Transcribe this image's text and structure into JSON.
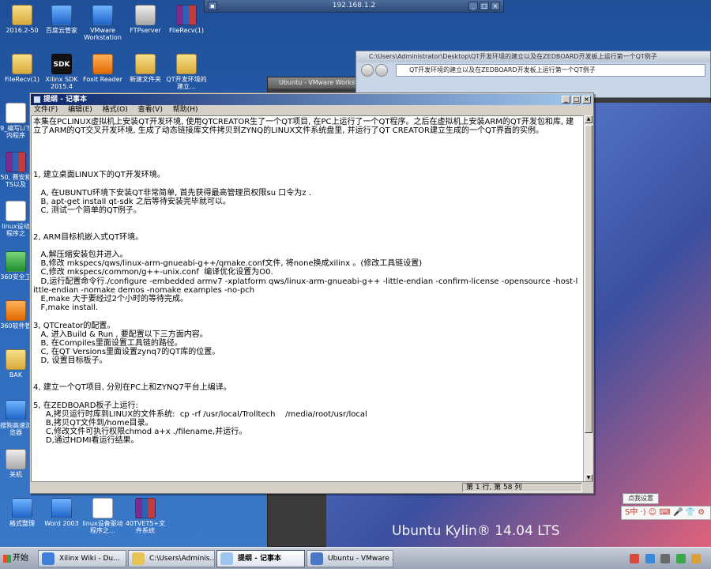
{
  "desktop": {
    "icons": [
      {
        "label": "2016.2-50",
        "icon": "folder-icon"
      },
      {
        "label": "百度云管家",
        "icon": "baidu-cloud-icon"
      },
      {
        "label": "VMware Workstation",
        "icon": "vmware-icon"
      },
      {
        "label": "FTPserver",
        "icon": "ftp-server-icon"
      },
      {
        "label": "FileRecv(1)",
        "icon": "winrar-archive-icon"
      },
      {
        "label": "FileRecv(1)",
        "icon": "folder-icon"
      },
      {
        "label": "Xilinx SDK 2015.4",
        "icon": "xilinx-sdk-icon"
      },
      {
        "label": "Foxit Reader",
        "icon": "foxit-reader-icon"
      },
      {
        "label": "新建文件夹",
        "icon": "folder-icon"
      },
      {
        "label": "QT开发环境的建立…",
        "icon": "folder-icon"
      },
      {
        "label": "9_编写Li下内程序",
        "icon": "document-icon"
      },
      {
        "label": "50, 赛安和TS以及",
        "icon": "winrar-archive-icon"
      },
      {
        "label": "linux设动程序之",
        "icon": "document-icon"
      },
      {
        "label": "360安全卫",
        "icon": "security-360-icon"
      },
      {
        "label": "360软件管",
        "icon": "software-360-icon"
      },
      {
        "label": "BAK",
        "icon": "folder-icon"
      },
      {
        "label": "搜狗高速浏览器",
        "icon": "sogou-browser-icon"
      },
      {
        "label": "关机",
        "icon": "shutdown-icon"
      },
      {
        "label": "格式整理",
        "icon": "format-tool-icon"
      },
      {
        "label": "Word 2003",
        "icon": "word-icon"
      },
      {
        "label": "linux设备驱动程序之…",
        "icon": "document-icon"
      },
      {
        "label": "40TVET5+文件系统",
        "icon": "winrar-archive-icon"
      }
    ]
  },
  "remote_bar": {
    "host": "192.168.1.2"
  },
  "explorer": {
    "title": "C:\\Users\\Administrator\\Desktop\\QT开发环境的建立以及在ZEDBOARD开发板上运行第一个QT例子",
    "address": "QT开发环境的建立以及在ZEDBOARD开发板上运行第一个QT例子"
  },
  "vmware": {
    "title": "Ubuntu - VMware Workstation"
  },
  "ubuntu": {
    "logo": "Ubuntu Kylin® 14.04 LTS"
  },
  "ime": {
    "label": "点我设置",
    "bar": "S中 ·) ☺ ⌨ 🎤 👕 ⚙"
  },
  "notepad": {
    "title": "提纲 - 记事本",
    "menu": [
      "文件(F)",
      "编辑(E)",
      "格式(O)",
      "查看(V)",
      "帮助(H)"
    ],
    "text": "本集在PCLINUX虚拟机上安装QT开发环境, 使用QTCREATOR生了一个QT项目, 在PC上运行了一个QT程序。之后在虚拟机上安装ARM的QT开发包和库, 建立了ARM的QT交叉开发环境, 生成了动态链接库文件拷贝到ZYNQ的LINUX文件系统盘里, 并运行了QT CREATOR建立生成的一个QT界面的实例。\n\n\n\n\n1, 建立桌面LINUX下的QT开发环境。\n\n   A, 在UBUNTU环境下安装QT非常简单, 首先获得最高管理员权限su 口令为z .\n   B, apt-get install qt-sdk 之后等待安装完毕就可以。\n   C, 测试一个简单的QT例子。\n\n\n2, ARM目标机嵌入式QT环境。\n\n   A,解压缩安装包并进入。\n   B,修改 mkspecs/qws/linux-arm-gnueabi-g++/qmake.conf文件, 将none换成xilinx 。(修改工具链设置)\n   C,修改 mkspecs/common/g++-unix.conf  编译优化设置为O0.\n   D,运行配置命令行./configure -embedded armv7 -xplatform qws/linux-arm-gnueabi-g++ -little-endian -confirm-license -opensource -host-little-endian -nomake demos -nomake examples -no-pch\n   E,make 大于要经过2个小时的等待完成。\n   F,make install.\n\n3, QTCreator的配置。\n   A, 进入Build & Run , 要配置以下三方面内容。\n   B, 在Compiles里面设置工具链的路径。\n   C, 在QT Versions里面设置zynq7的QT库的位置。\n   D, 设置目标板子。\n\n\n4, 建立一个QT项目, 分别在PC上和ZYNQ7平台上编译。\n\n5, 在ZEDBOARD板子上运行:\n     A,拷贝运行时库到LINUX的文件系统:  cp -rf /usr/local/Trolltech    /media/root/usr/local\n     B,拷贝QT文件到/home目录。\n     C,修改文件可执行权限chmod a+x ./filename,并运行。\n     D,通过HDMI看运行结果。",
    "status": "第 1 行, 第 58 列"
  },
  "taskbar": {
    "start": "开始",
    "tasks": [
      {
        "label": "Xilinx Wiki - Du...",
        "icon": "sogou-browser-icon"
      },
      {
        "label": "C:\\Users\\Adminis...",
        "icon": "folder-icon"
      },
      {
        "label": "提纲 - 记事本",
        "icon": "notepad-icon"
      },
      {
        "label": "Ubuntu - VMware ...",
        "icon": "vmware-icon"
      }
    ]
  }
}
